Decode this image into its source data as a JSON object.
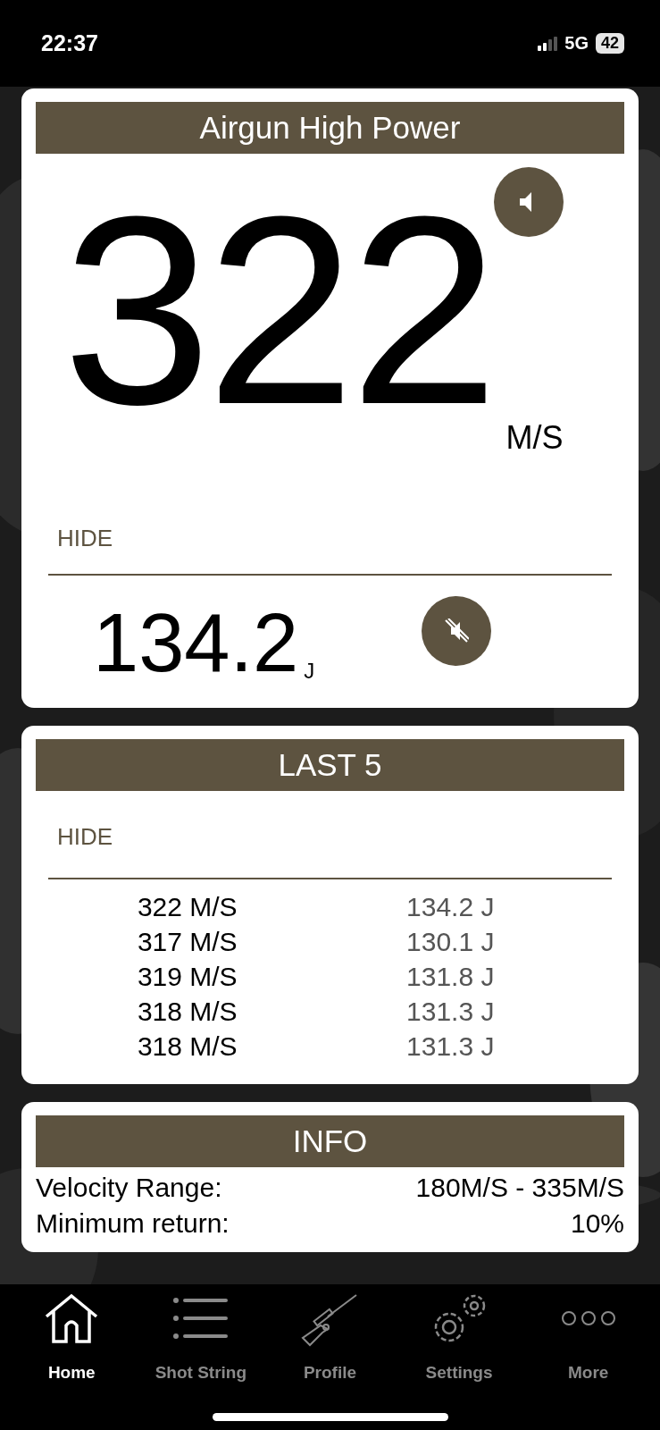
{
  "status_bar": {
    "time": "22:37",
    "network": "5G",
    "battery": "42"
  },
  "velocity_card": {
    "title": "Airgun High Power",
    "value": "322",
    "unit": "M/S",
    "sound_muted": false,
    "hide_label": "HIDE",
    "energy": "134.2",
    "energy_unit": "J",
    "energy_sound_muted": true
  },
  "last_shots": {
    "title": "LAST 5",
    "hide_label": "HIDE",
    "rows": [
      {
        "velocity": "322 M/S",
        "energy": "134.2 J"
      },
      {
        "velocity": "317 M/S",
        "energy": "130.1 J"
      },
      {
        "velocity": "319 M/S",
        "energy": "131.8 J"
      },
      {
        "velocity": "318 M/S",
        "energy": "131.3 J"
      },
      {
        "velocity": "318 M/S",
        "energy": "131.3 J"
      }
    ]
  },
  "info": {
    "title": "INFO",
    "rows": [
      {
        "label": "Velocity Range:",
        "value": "180M/S - 335M/S"
      },
      {
        "label": "Minimum return:",
        "value": "10%"
      }
    ]
  },
  "tab_bar": [
    {
      "kind": "home",
      "label": "Home",
      "selected": true
    },
    {
      "kind": "list",
      "label": "Shot String",
      "selected": false
    },
    {
      "kind": "rifle",
      "label": "Profile",
      "selected": false
    },
    {
      "kind": "gears",
      "label": "Settings",
      "selected": false
    },
    {
      "kind": "more",
      "label": "More",
      "selected": false
    }
  ]
}
